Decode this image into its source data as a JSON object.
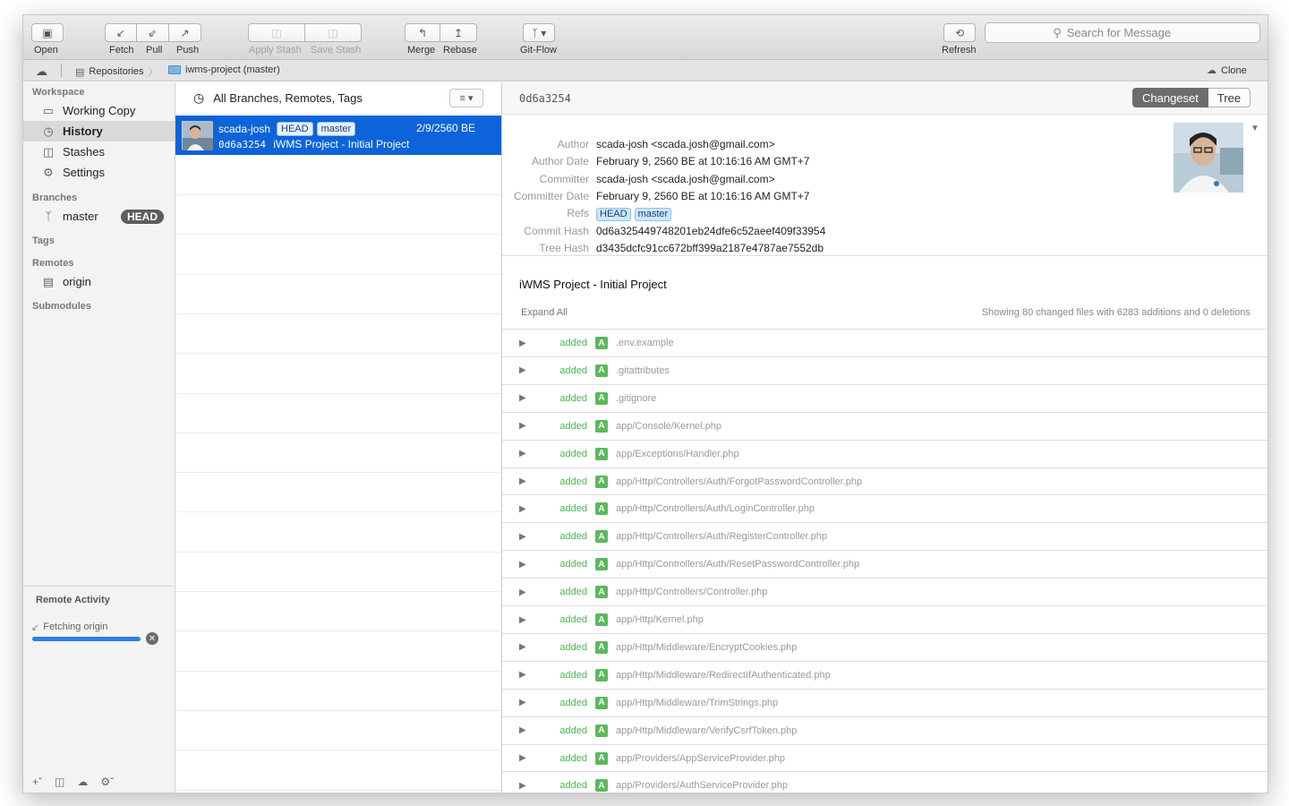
{
  "toolbar": {
    "open": "Open",
    "fetch": "Fetch",
    "pull": "Pull",
    "push": "Push",
    "apply_stash": "Apply Stash",
    "save_stash": "Save Stash",
    "merge": "Merge",
    "rebase": "Rebase",
    "gitflow": "Git-Flow",
    "refresh": "Refresh",
    "search_placeholder": "Search for Message"
  },
  "breadcrumb": {
    "repositories": "Repositories",
    "project": "iwms-project (master)",
    "clone": "Clone"
  },
  "sidebar": {
    "workspace_title": "Workspace",
    "workspace_items": [
      {
        "label": "Working Copy"
      },
      {
        "label": "History"
      },
      {
        "label": "Stashes"
      },
      {
        "label": "Settings"
      }
    ],
    "branches_title": "Branches",
    "branch_name": "master",
    "head_badge": "HEAD",
    "tags_title": "Tags",
    "remotes_title": "Remotes",
    "remote_name": "origin",
    "submodules_title": "Submodules",
    "remote_activity_title": "Remote Activity",
    "fetching_text": "Fetching origin",
    "fetch_progress": 1.0
  },
  "commit_list": {
    "filter_label": "All Branches, Remotes, Tags",
    "commits": [
      {
        "author": "scada-josh",
        "refs": [
          "HEAD",
          "master"
        ],
        "date": "2/9/2560 BE",
        "hash": "0d6a3254",
        "message": "iWMS Project - Initial Project"
      }
    ]
  },
  "detail": {
    "short_hash": "0d6a3254",
    "tab_changeset": "Changeset",
    "tab_tree": "Tree",
    "labels": {
      "author": "Author",
      "author_date": "Author Date",
      "committer": "Committer",
      "committer_date": "Committer Date",
      "refs": "Refs",
      "commit_hash": "Commit Hash",
      "tree_hash": "Tree Hash"
    },
    "author": "scada-josh <scada.josh@gmail.com>",
    "author_date": "February 9, 2560 BE at 10:16:16 AM GMT+7",
    "committer": "scada-josh <scada.josh@gmail.com>",
    "committer_date": "February 9, 2560 BE at 10:16:16 AM GMT+7",
    "refs": [
      "HEAD",
      "master"
    ],
    "commit_hash": "0d6a325449748201eb24dfe6c52aeef409f33954",
    "tree_hash": "d3435dcfc91cc672bff399a2187e4787ae7552db",
    "subject": "iWMS Project - Initial Project",
    "expand_all": "Expand All",
    "summary": "Showing 80 changed files with 6283 additions and 0 deletions",
    "files": [
      {
        "status": "added",
        "badge": "A",
        "path": ".env.example"
      },
      {
        "status": "added",
        "badge": "A",
        "path": ".gitattributes"
      },
      {
        "status": "added",
        "badge": "A",
        "path": ".gitignore"
      },
      {
        "status": "added",
        "badge": "A",
        "path": "app/Console/Kernel.php"
      },
      {
        "status": "added",
        "badge": "A",
        "path": "app/Exceptions/Handler.php"
      },
      {
        "status": "added",
        "badge": "A",
        "path": "app/Http/Controllers/Auth/ForgotPasswordController.php"
      },
      {
        "status": "added",
        "badge": "A",
        "path": "app/Http/Controllers/Auth/LoginController.php"
      },
      {
        "status": "added",
        "badge": "A",
        "path": "app/Http/Controllers/Auth/RegisterController.php"
      },
      {
        "status": "added",
        "badge": "A",
        "path": "app/Http/Controllers/Auth/ResetPasswordController.php"
      },
      {
        "status": "added",
        "badge": "A",
        "path": "app/Http/Controllers/Controller.php"
      },
      {
        "status": "added",
        "badge": "A",
        "path": "app/Http/Kernel.php"
      },
      {
        "status": "added",
        "badge": "A",
        "path": "app/Http/Middleware/EncryptCookies.php"
      },
      {
        "status": "added",
        "badge": "A",
        "path": "app/Http/Middleware/RedirectIfAuthenticated.php"
      },
      {
        "status": "added",
        "badge": "A",
        "path": "app/Http/Middleware/TrimStrings.php"
      },
      {
        "status": "added",
        "badge": "A",
        "path": "app/Http/Middleware/VerifyCsrfToken.php"
      },
      {
        "status": "added",
        "badge": "A",
        "path": "app/Providers/AppServiceProvider.php"
      },
      {
        "status": "added",
        "badge": "A",
        "path": "app/Providers/AuthServiceProvider.php"
      }
    ]
  }
}
